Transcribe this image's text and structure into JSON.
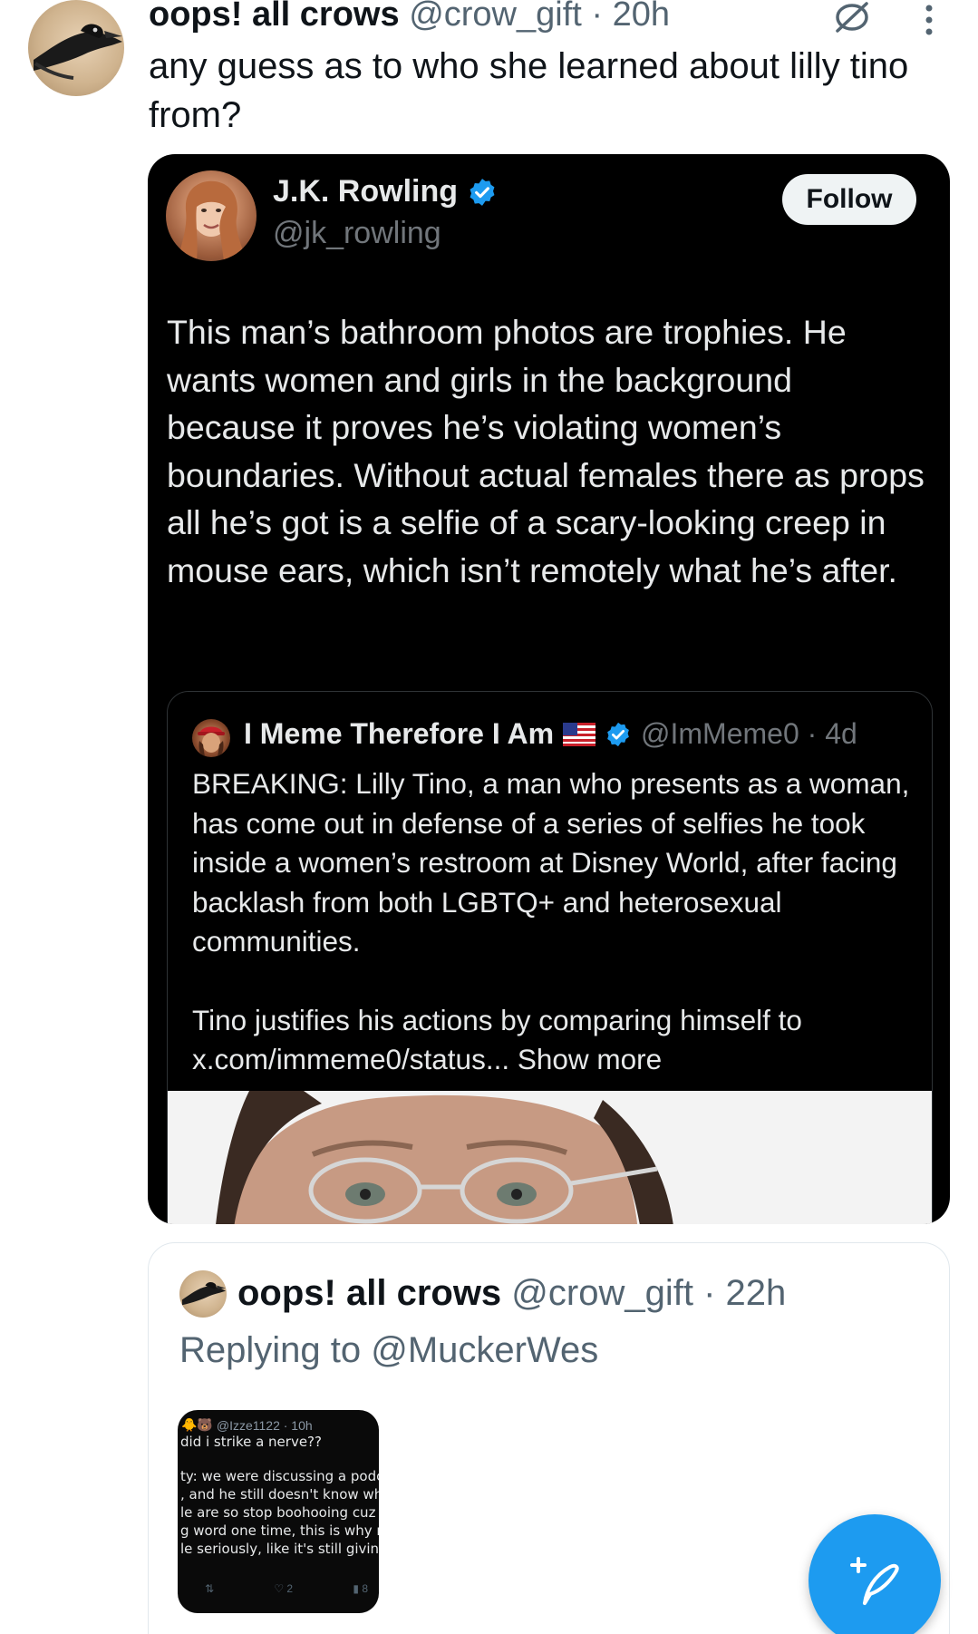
{
  "top_tweet": {
    "display_name": "oops! all crows",
    "handle_time": "@crow_gift · 20h",
    "text": "any guess as to who she learned about lilly tino from?"
  },
  "quoted_tweet": {
    "display_name": "J.K. Rowling",
    "handle": "@jk_rowling",
    "follow_label": "Follow",
    "text": "This man’s bathroom photos are trophies. He wants women and girls in the background because it proves he’s violating women’s boundaries. Without actual females there as props all he’s got is a selfie of a scary-looking creep in mouse ears, which isn’t remotely what he’s after."
  },
  "nested_quote": {
    "display_name": "I Meme Therefore I Am",
    "handle_time": "@ImMeme0 · 4d",
    "paragraph1": "BREAKING: Lilly Tino, a man who presents as a woman, has come out in defense of a series of selfies he took inside a women’s restroom at Disney World, after facing backlash from both LGBTQ+ and heterosexual communities.",
    "paragraph2": "Tino justifies his actions by comparing himself to x.com/immeme0/status...",
    "show_more": "Show more"
  },
  "reply_tweet": {
    "display_name": "oops! all crows",
    "handle_time": "@crow_gift · 22h",
    "replying_prefix": "Replying to",
    "replying_to": "@MuckerWes"
  },
  "thumbnail": {
    "header": "@Izze1122 · 10h",
    "lines": [
      "did i strike a nerve??",
      "ty: we were discussing a podca",
      ", and he still doesn't know who",
      "le are so stop boohooing cuz h",
      "g word one time, this is why no",
      "le seriously, like it's still giving"
    ],
    "reply_count": "",
    "like_count": "2",
    "view_count": "8"
  },
  "icons": {
    "verified": "verified-badge-icon",
    "grok": "grok-icon",
    "more": "more-vertical-icon",
    "compose": "compose-post-icon",
    "flag": "us-flag-icon"
  },
  "colors": {
    "accent": "#1d9bf0",
    "dark_card": "#000000",
    "muted_text": "#536471"
  }
}
